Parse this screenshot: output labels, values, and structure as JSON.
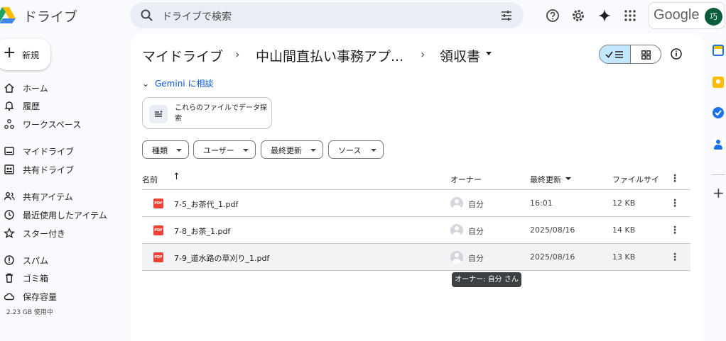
{
  "app": {
    "name": "ドライブ"
  },
  "search": {
    "placeholder": "ドライブで検索"
  },
  "account": {
    "brand": "Google",
    "avatar_initial": "巧"
  },
  "sidebar": {
    "new_label": "新規",
    "items": [
      {
        "label": "ホーム",
        "icon": "home-icon"
      },
      {
        "label": "履歴",
        "icon": "bell-icon"
      },
      {
        "label": "ワークスペース",
        "icon": "workspace-icon"
      },
      {
        "label": "マイドライブ",
        "icon": "my-drive-icon"
      },
      {
        "label": "共有ドライブ",
        "icon": "shared-drive-icon"
      },
      {
        "label": "共有アイテム",
        "icon": "people-icon"
      },
      {
        "label": "最近使用したアイテム",
        "icon": "clock-icon"
      },
      {
        "label": "スター付き",
        "icon": "star-icon"
      },
      {
        "label": "スパム",
        "icon": "spam-icon"
      },
      {
        "label": "ゴミ箱",
        "icon": "trash-icon"
      },
      {
        "label": "保存容量",
        "icon": "cloud-icon"
      }
    ],
    "storage_text": "2.23 GB 使用中"
  },
  "breadcrumb": {
    "items": [
      "マイドライブ",
      "中山間直払い事務アプ...",
      "領収書"
    ],
    "separator": "›"
  },
  "gemini": {
    "label": "Gemini に相談",
    "suggestion": "これらのファイルでデータ探索"
  },
  "filters": [
    "種類",
    "ユーザー",
    "最終更新",
    "ソース"
  ],
  "table": {
    "columns": {
      "name": "名前",
      "owner": "オーナー",
      "modified": "最終更新",
      "size": "ファイルサイ"
    },
    "rows": [
      {
        "name": "7-5_お茶代_1.pdf",
        "owner": "自分",
        "modified": "16:01",
        "size": "12 KB",
        "type": "PDF"
      },
      {
        "name": "7-8_お茶_1.pdf",
        "owner": "自分",
        "modified": "2025/08/16",
        "size": "14 KB",
        "type": "PDF"
      },
      {
        "name": "7-9_道水路の草刈り_1.pdf",
        "owner": "自分",
        "modified": "2025/08/16",
        "size": "13 KB",
        "type": "PDF"
      }
    ]
  },
  "tooltip": "オーナー: 自分 さん",
  "colors": {
    "accent": "#0b57d0",
    "selected_toggle": "#c2e7ff",
    "pdf": "#ea4335",
    "avatar": "#0b5c3b"
  }
}
